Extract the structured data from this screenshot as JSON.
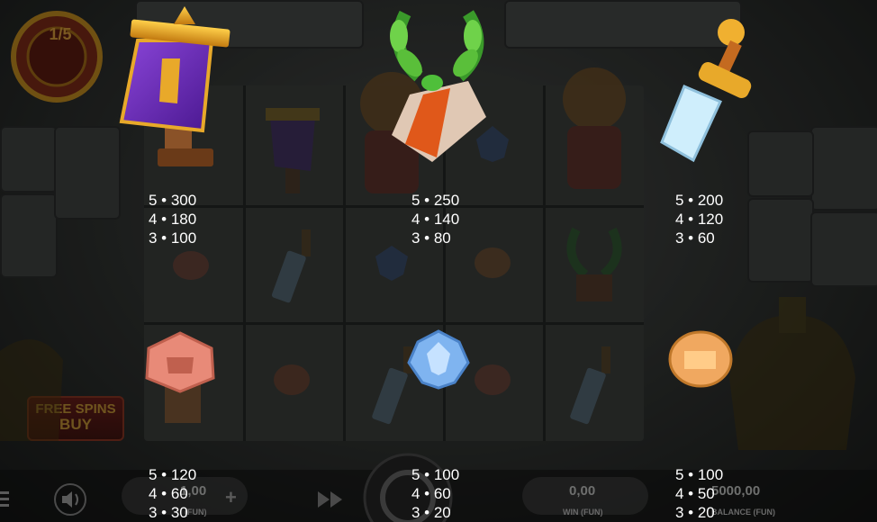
{
  "game": {
    "counter_text": "1/5",
    "free_spins_buy_line1": "FREE SPINS",
    "free_spins_buy_line2": "BUY"
  },
  "paytable": [
    {
      "symbol": "banner-icon",
      "lines": [
        "5 • 300",
        "4 • 180",
        "3 • 100"
      ]
    },
    {
      "symbol": "laurel-wreath-icon",
      "lines": [
        "5 • 250",
        "4 • 140",
        "3 • 80"
      ]
    },
    {
      "symbol": "sword-icon",
      "lines": [
        "5 • 200",
        "4 • 120",
        "3 • 60"
      ]
    },
    {
      "symbol": "pink-shield-icon",
      "lines": [
        "5 • 120",
        "4 • 60",
        "3 • 30"
      ]
    },
    {
      "symbol": "blue-eagle-icon",
      "lines": [
        "5 • 100",
        "4 • 60",
        "3 • 20"
      ]
    },
    {
      "symbol": "fist-icon",
      "lines": [
        "5 • 100",
        "4 • 50",
        "3 • 20"
      ]
    }
  ],
  "bottom_bar": {
    "bet_value": "1,00",
    "bet_label": "(FUN)",
    "win_value": "0,00",
    "win_label": "WIN (FUN)",
    "balance_value": "5000,00",
    "balance_label": "BALANCE (FUN)"
  },
  "colors": {
    "banner_purple": "#6a2bb0",
    "banner_gold": "#e8a92a",
    "laurel_green": "#4fbf3a",
    "sword_blade": "#bfe4f5",
    "shield_pink": "#e88a78",
    "eagle_blue": "#7fb4f0",
    "fist_orange": "#f0a860"
  }
}
